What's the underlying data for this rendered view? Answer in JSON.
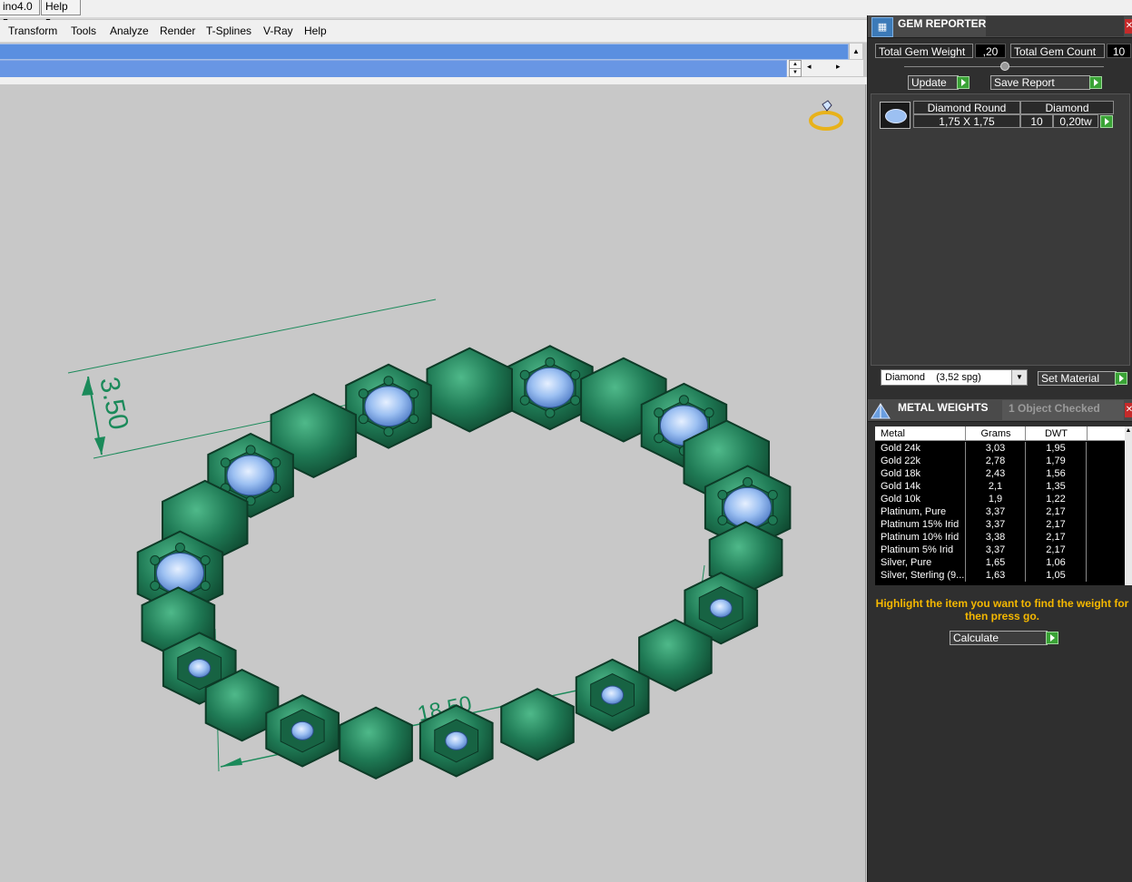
{
  "os_bar": {
    "app_menu": "ino4.0",
    "help_menu": "Help"
  },
  "menubar": {
    "items": [
      "Transform",
      "Tools",
      "Analyze",
      "Render",
      "T-Splines",
      "V-Ray",
      "Help"
    ]
  },
  "viewport": {
    "dimension_height": "3.50",
    "dimension_width": "18.50",
    "colors": {
      "background": "#c8c8c8",
      "metal": "#1f7a55",
      "gem": "#9cc0f2",
      "dimension": "#1b8a5a"
    }
  },
  "gem_reporter": {
    "title": "GEM REPORTER",
    "total_weight_label": "Total Gem Weight",
    "total_weight_value": ",20",
    "total_count_label": "Total Gem Count",
    "total_count_value": "10",
    "update_button": "Update",
    "save_report_button": "Save Report",
    "gem": {
      "shape": "Diamond Round",
      "material": "Diamond",
      "size": "1,75 X 1,75",
      "count": "10",
      "weight": "0,20tw"
    },
    "material_select": "Diamond    (3,52 spg)",
    "set_material_button": "Set Material"
  },
  "metal_weights": {
    "title": "METAL WEIGHTS",
    "status": "1 Object Checked",
    "columns": [
      "Metal",
      "Grams",
      "DWT"
    ],
    "rows": [
      [
        "Gold 24k",
        "3,03",
        "1,95"
      ],
      [
        "Gold 22k",
        "2,78",
        "1,79"
      ],
      [
        "Gold 18k",
        "2,43",
        "1,56"
      ],
      [
        "Gold 14k",
        "2,1",
        "1,35"
      ],
      [
        "Gold 10k",
        "1,9",
        "1,22"
      ],
      [
        "Platinum, Pure",
        "3,37",
        "2,17"
      ],
      [
        "Platinum 15% Irid",
        "3,37",
        "2,17"
      ],
      [
        "Platinum 10% Irid",
        "3,38",
        "2,17"
      ],
      [
        "Platinum 5% Irid",
        "3,37",
        "2,17"
      ],
      [
        "Silver, Pure",
        "1,65",
        "1,06"
      ],
      [
        "Silver, Sterling (9...",
        "1,63",
        "1,05"
      ]
    ],
    "instruction_line1": "Highlight the item you want to find the weight for",
    "instruction_line2": "then press go.",
    "calculate_button": "Calculate"
  }
}
